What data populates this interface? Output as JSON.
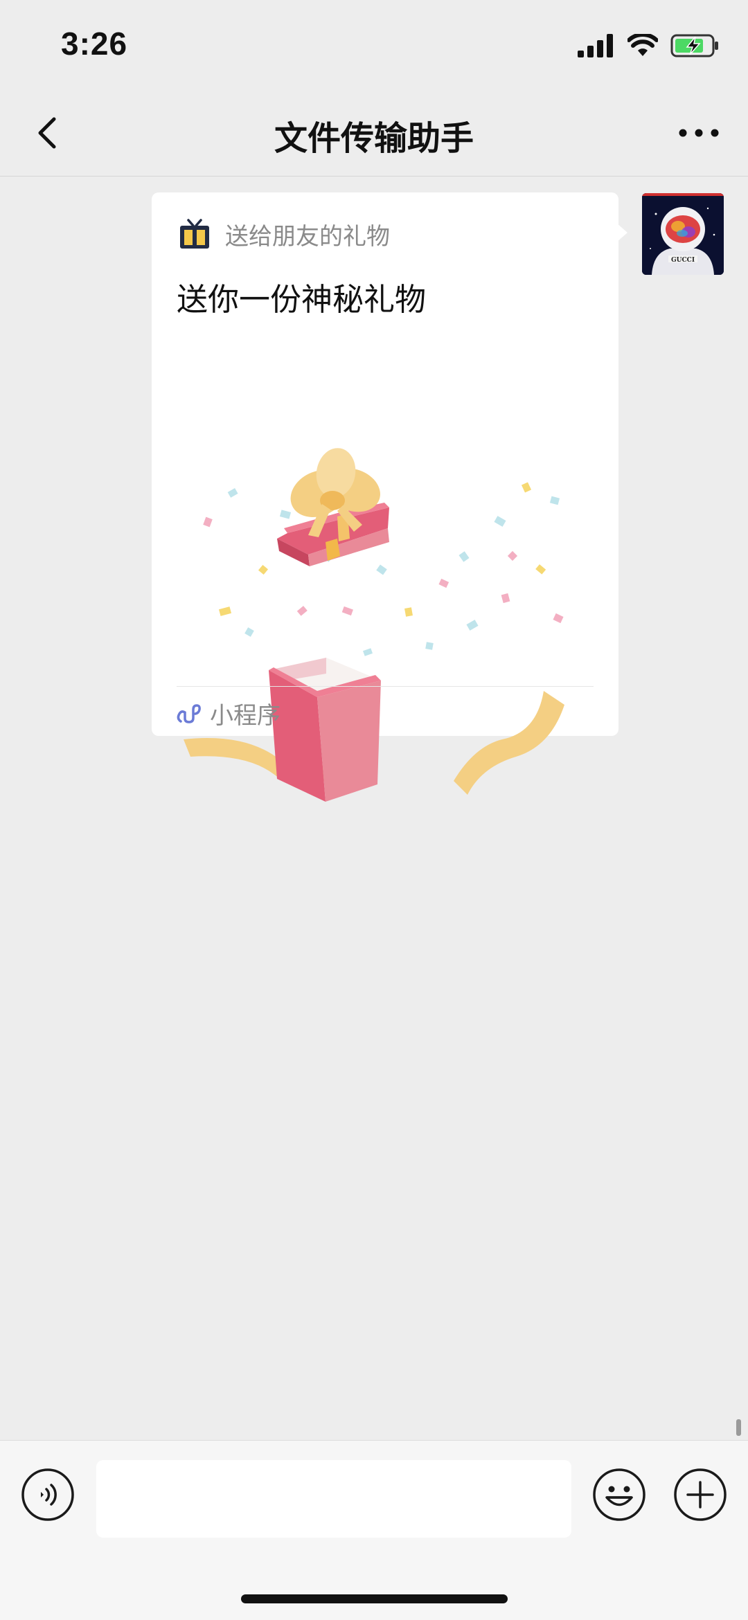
{
  "status_bar": {
    "time": "3:26"
  },
  "nav": {
    "title": "文件传输助手"
  },
  "message": {
    "card": {
      "source_label": "送给朋友的礼物",
      "title": "送你一份神秘礼物",
      "type_label": "小程序"
    },
    "avatar_text": "GUCCI"
  },
  "input": {
    "value": "",
    "placeholder": ""
  },
  "colors": {
    "background": "#ededed",
    "card": "#ffffff",
    "gift_red": "#e35e78",
    "ribbon": "#f4cf83",
    "mini_program_link": "#6b7bd6"
  }
}
